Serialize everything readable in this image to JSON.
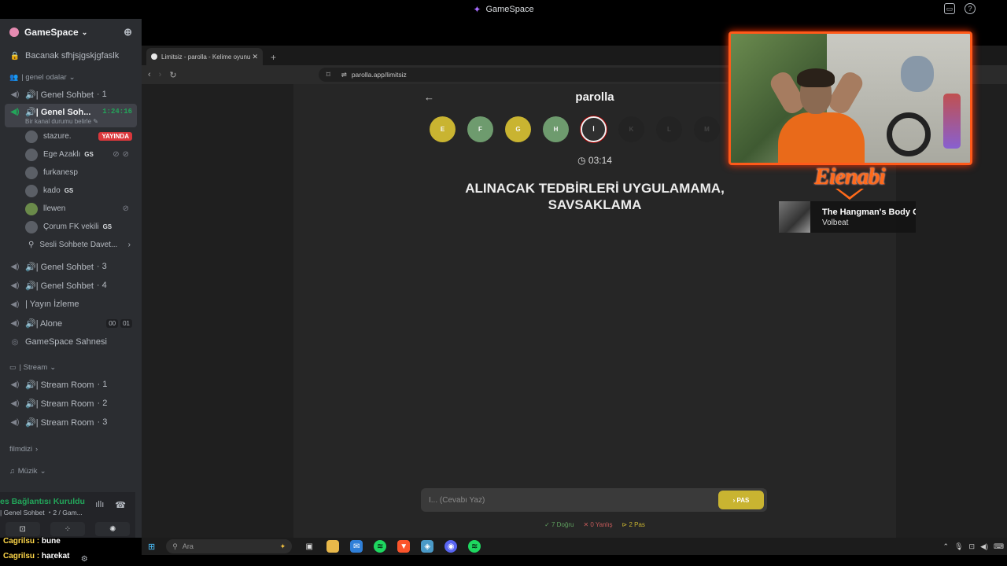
{
  "window": {
    "app_title": "GameSpace"
  },
  "sidebar": {
    "server_name": "GameSpace",
    "items": [
      {
        "type": "channel",
        "icon": "lock-icon",
        "label": "Bacanak sfhjsjgskjgfaslk"
      },
      {
        "type": "category",
        "label": "| genel odalar"
      },
      {
        "type": "channel",
        "icon": "voice-icon",
        "label": "🔊| Genel Sohbet",
        "count": "1"
      }
    ],
    "active_channel": {
      "label": "🔊| Genel Soh...",
      "timer": "1:24:16",
      "status": "Bir kanal durumu belirle"
    },
    "users": [
      {
        "name": "stazure.",
        "live": "YAYINDA"
      },
      {
        "name": "Ege Azaklı",
        "tag": "GS"
      },
      {
        "name": "furkanesp"
      },
      {
        "name": "kado",
        "tag": "GS"
      },
      {
        "name": "llewen"
      },
      {
        "name": "Çorum FK vekili",
        "tag": "GS"
      }
    ],
    "invite_label": "Sesli Sohbete Davet...",
    "more_channels": [
      {
        "label": "🔊| Genel Sohbet",
        "count": "3"
      },
      {
        "label": "🔊| Genel Sohbet",
        "count": "4"
      },
      {
        "label": "| Yayın İzleme"
      },
      {
        "label": "🔊| Alone",
        "badges": [
          "00",
          "01"
        ]
      },
      {
        "label": "GameSpace Sahnesi"
      }
    ],
    "stream_category": "| Stream",
    "stream_rooms": [
      {
        "label": "🔊| Stream Room",
        "count": "1"
      },
      {
        "label": "🔊| Stream Room",
        "count": "2"
      },
      {
        "label": "🔊| Stream Room",
        "count": "3"
      }
    ],
    "category_filmdizi": "filmdizi",
    "category_muzik": "Müzik"
  },
  "voice_panel": {
    "status": "es Bağlantısı Kuruldu",
    "sub": "| Genel Sohbet ・2 / Gam..."
  },
  "browser": {
    "tab_title": "Limitsiz - parolla - Kelime oyunu",
    "url": "parolla.app/limitsiz"
  },
  "game": {
    "title": "parolla",
    "letters": [
      {
        "char": "E",
        "state": "yellow"
      },
      {
        "char": "F",
        "state": "green"
      },
      {
        "char": "G",
        "state": "yellow"
      },
      {
        "char": "H",
        "state": "green"
      },
      {
        "char": "İ",
        "state": "current"
      },
      {
        "char": "K",
        "state": "pending"
      },
      {
        "char": "L",
        "state": "pending"
      },
      {
        "char": "M",
        "state": "pending"
      }
    ],
    "timer": "03:14",
    "clue_line1": "ALINACAK TEDBİRLERİ UYGULAMAMA,",
    "clue_line2": "SAVSAKLAMA",
    "answer_placeholder": "İ... (Cevabı Yaz)",
    "pas_label": "› PAS",
    "score_correct": "✓ 7 Doğru",
    "score_wrong": "✕ 0 Yanlış",
    "score_pass": "⊳ 2 Pas"
  },
  "overlay": {
    "brand": "Eienabi",
    "now_playing_title": "The Hangman's Body Co",
    "now_playing_artist": "Volbeat"
  },
  "taskbar": {
    "search_placeholder": "Ara"
  },
  "chat": [
    {
      "user": "Cagrilsu",
      "msg": "bune"
    },
    {
      "user": "Cagrilsu",
      "msg": "harekat"
    }
  ],
  "colors": {
    "accent_yellow": "#c9b431",
    "accent_green": "#6e9b6e",
    "discord_green": "#23a55a",
    "overlay_orange": "#ff6a1a"
  }
}
